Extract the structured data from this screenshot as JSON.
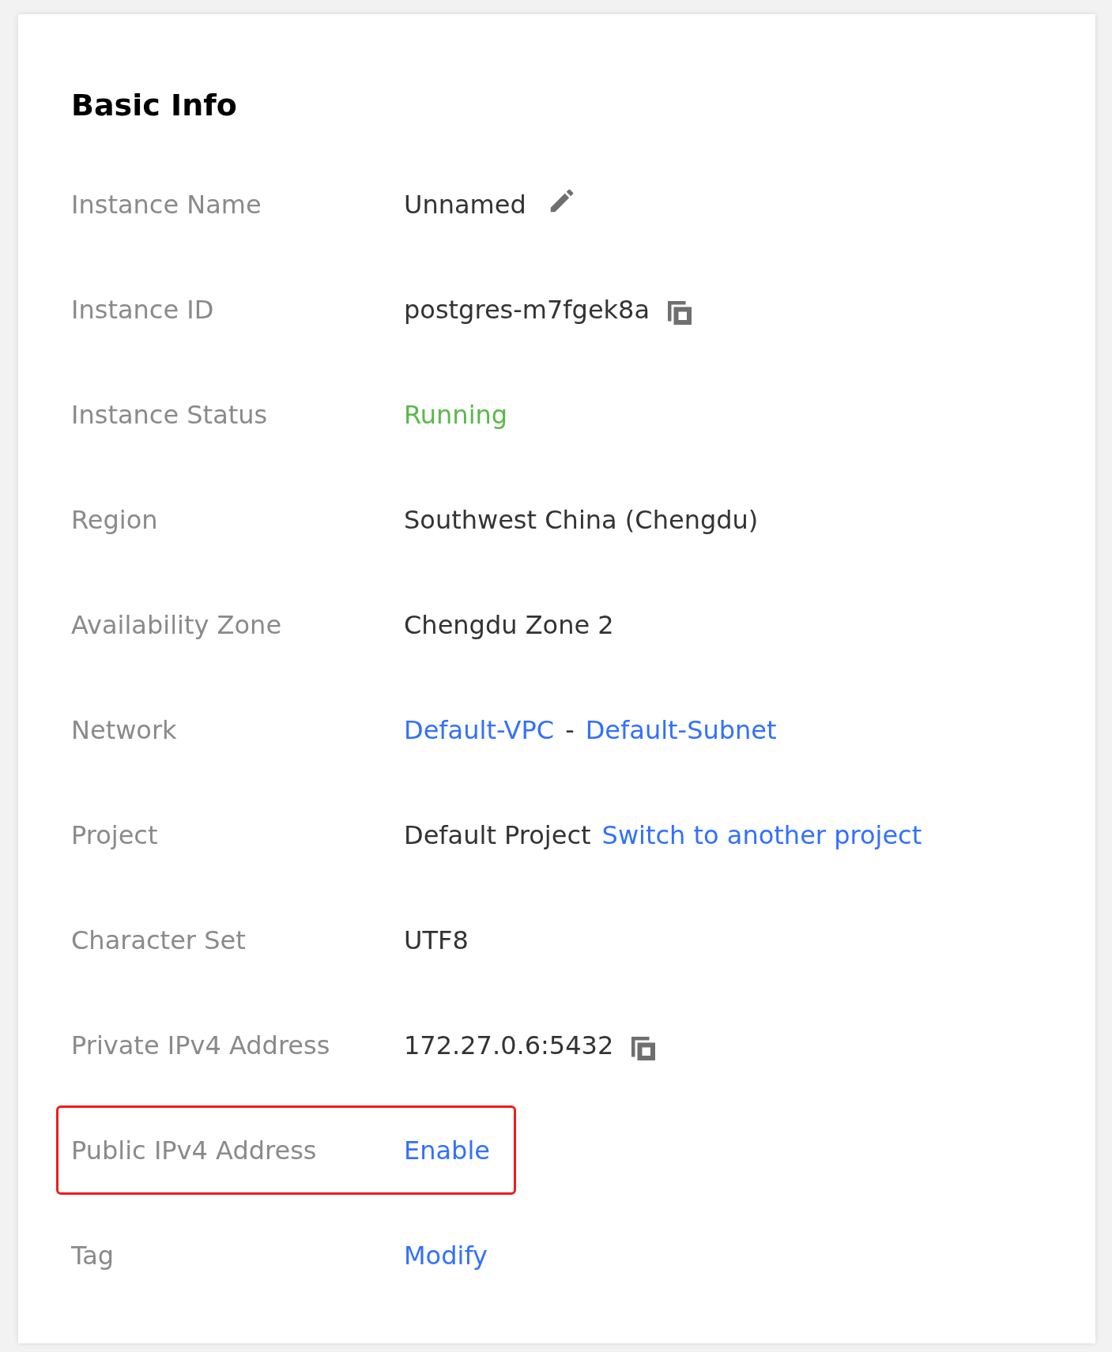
{
  "card": {
    "title": "Basic Info",
    "rows": [
      {
        "label": "Instance Name",
        "value": [
          {
            "kind": "text",
            "text": "Unnamed"
          }
        ],
        "kind": "editable",
        "highlighted": false
      },
      {
        "label": "Instance ID",
        "value": [
          {
            "kind": "text",
            "text": "postgres-m7fgek8a"
          }
        ],
        "kind": "copyable",
        "highlighted": false
      },
      {
        "label": "Instance Status",
        "value": [
          {
            "kind": "status",
            "text": "Running"
          }
        ],
        "highlighted": false
      },
      {
        "label": "Region",
        "value": [
          {
            "kind": "text",
            "text": "Southwest China (Chengdu)"
          }
        ],
        "highlighted": false
      },
      {
        "label": "Availability Zone",
        "value": [
          {
            "kind": "text",
            "text": "Chengdu Zone 2"
          }
        ],
        "highlighted": false
      },
      {
        "label": "Network",
        "value": [
          {
            "kind": "link",
            "text": "Default-VPC"
          },
          {
            "kind": "text",
            "text": "-"
          },
          {
            "kind": "link",
            "text": "Default-Subnet"
          }
        ],
        "highlighted": false
      },
      {
        "label": "Project",
        "value": [
          {
            "kind": "text",
            "text": "Default Project"
          },
          {
            "kind": "link",
            "text": "Switch to another project"
          }
        ],
        "highlighted": false
      },
      {
        "label": "Character Set",
        "value": [
          {
            "kind": "text",
            "text": "UTF8"
          }
        ],
        "highlighted": false
      },
      {
        "label": "Private IPv4 Address",
        "value": [
          {
            "kind": "text",
            "text": "172.27.0.6:5432"
          }
        ],
        "kind": "copyable",
        "highlighted": false
      },
      {
        "label": "Public IPv4 Address",
        "value": [
          {
            "kind": "link",
            "text": "Enable"
          }
        ],
        "highlighted": true
      },
      {
        "label": "Tag",
        "value": [
          {
            "kind": "link",
            "text": "Modify"
          }
        ],
        "highlighted": false
      }
    ]
  }
}
